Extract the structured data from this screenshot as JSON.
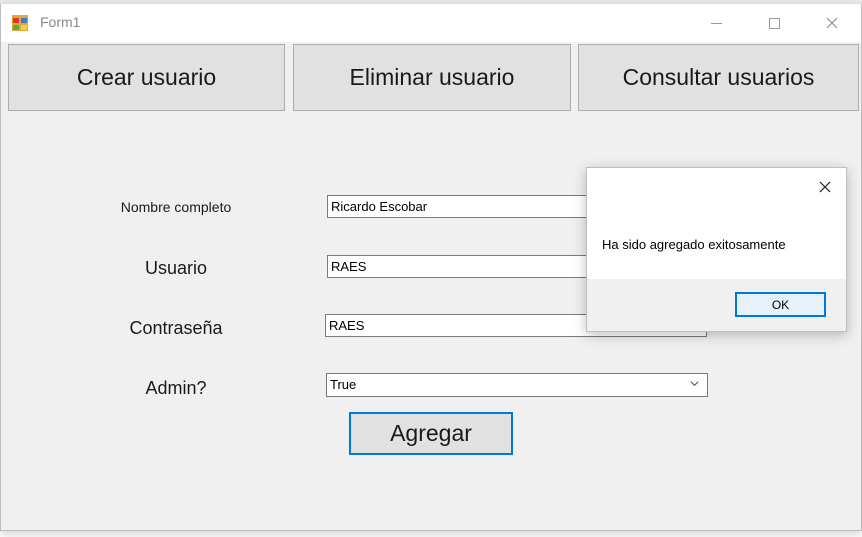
{
  "window": {
    "title": "Form1",
    "icon": "app-form-icon",
    "controls": [
      "minimize-icon",
      "maximize-icon",
      "close-icon"
    ]
  },
  "tabs": {
    "crear": "Crear usuario",
    "eliminar": "Eliminar usuario",
    "consultar": "Consultar usuarios"
  },
  "form": {
    "nombre_label": "Nombre completo",
    "nombre_value": "Ricardo Escobar",
    "usuario_label": "Usuario",
    "usuario_value": "RAES",
    "contrasena_label": "Contraseña",
    "contrasena_value": "RAES",
    "admin_label": "Admin?",
    "admin_value": "True",
    "submit_label": "Agregar"
  },
  "dialog": {
    "message": "Ha sido agregado exitosamente",
    "ok_label": "OK"
  },
  "colors": {
    "accent": "#0078d7",
    "button_bg": "#e1e1e1",
    "window_bg": "#f0f0f0"
  }
}
